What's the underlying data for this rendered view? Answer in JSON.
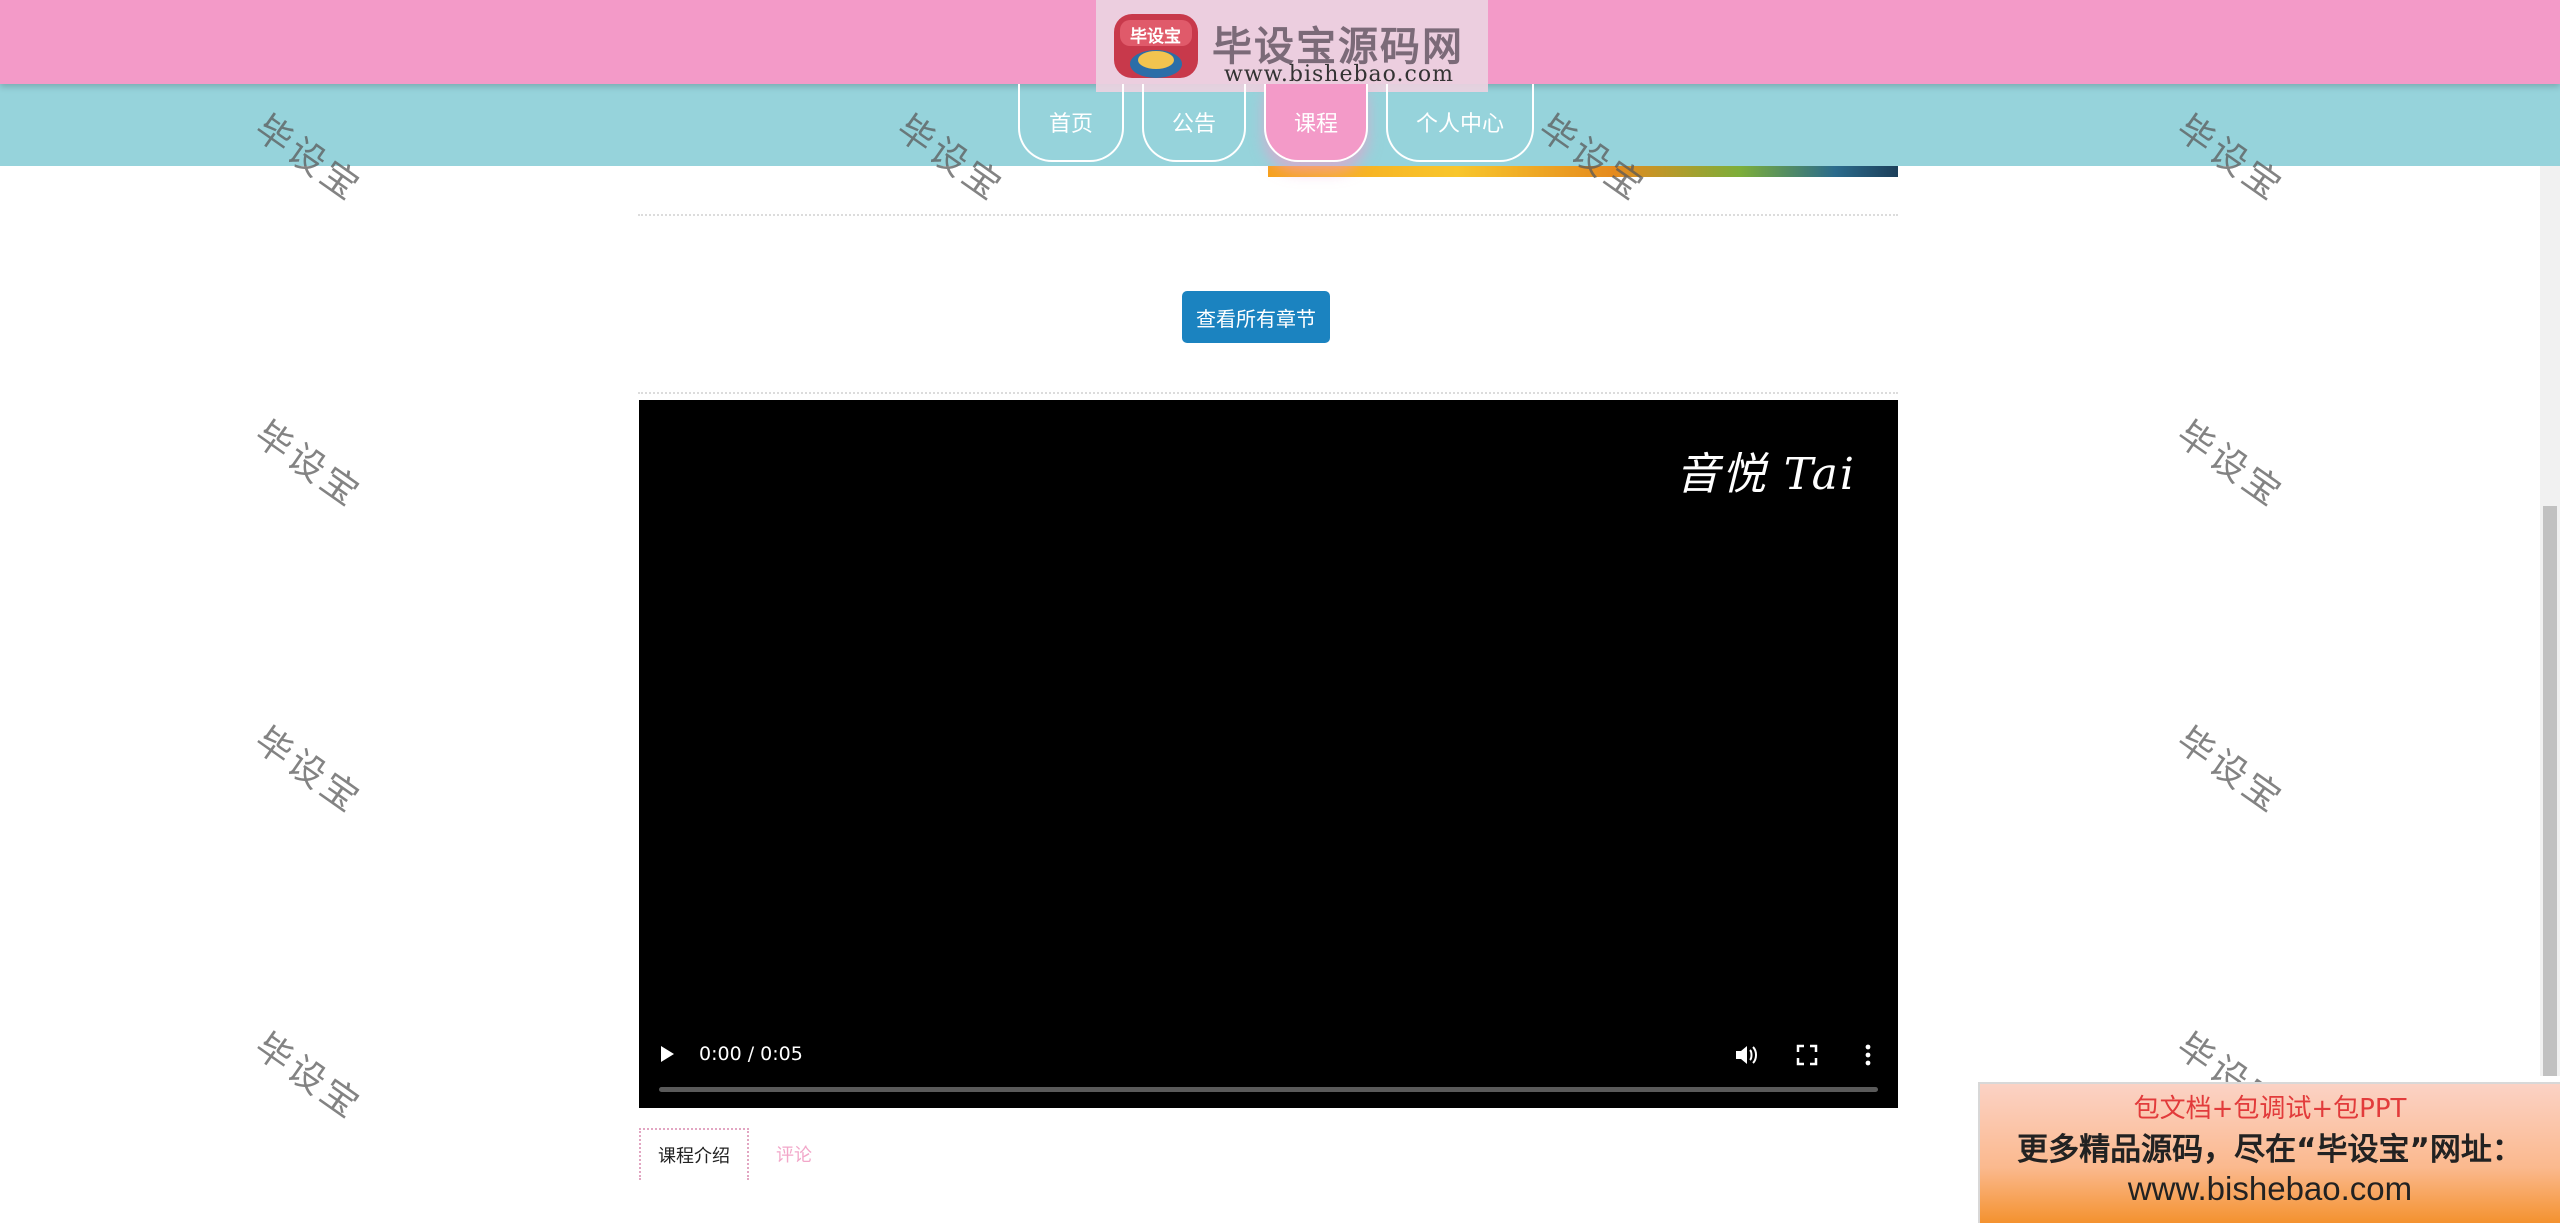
{
  "header": {
    "logo_badge": "毕设宝",
    "logo_title": "毕设宝源码网",
    "logo_url": "www.bishebao.com"
  },
  "nav": {
    "items": [
      {
        "label": "首页",
        "active": false
      },
      {
        "label": "公告",
        "active": false
      },
      {
        "label": "课程",
        "active": true
      },
      {
        "label": "个人中心",
        "active": false
      }
    ]
  },
  "main": {
    "chapters_button": "查看所有章节",
    "video": {
      "watermark": "音悦 Tai",
      "time": "0:00 / 0:05",
      "progress": 0,
      "icons": [
        "play-icon",
        "volume-icon",
        "fullscreen-icon",
        "more-options-icon"
      ]
    },
    "tabs": [
      {
        "label": "课程介绍",
        "active": true
      },
      {
        "label": "评论",
        "active": false
      }
    ]
  },
  "watermark_text": "毕设宝",
  "ad": {
    "line1": "包文档+包调试+包PPT",
    "line2": "更多精品源码，尽在“毕设宝”网址：",
    "line3": "www.bishebao.com"
  },
  "colors": {
    "top_bar": "#f39ac8",
    "nav_bar": "#96d3db",
    "button": "#1b83c0",
    "tab_inactive": "#f2a7c9"
  }
}
